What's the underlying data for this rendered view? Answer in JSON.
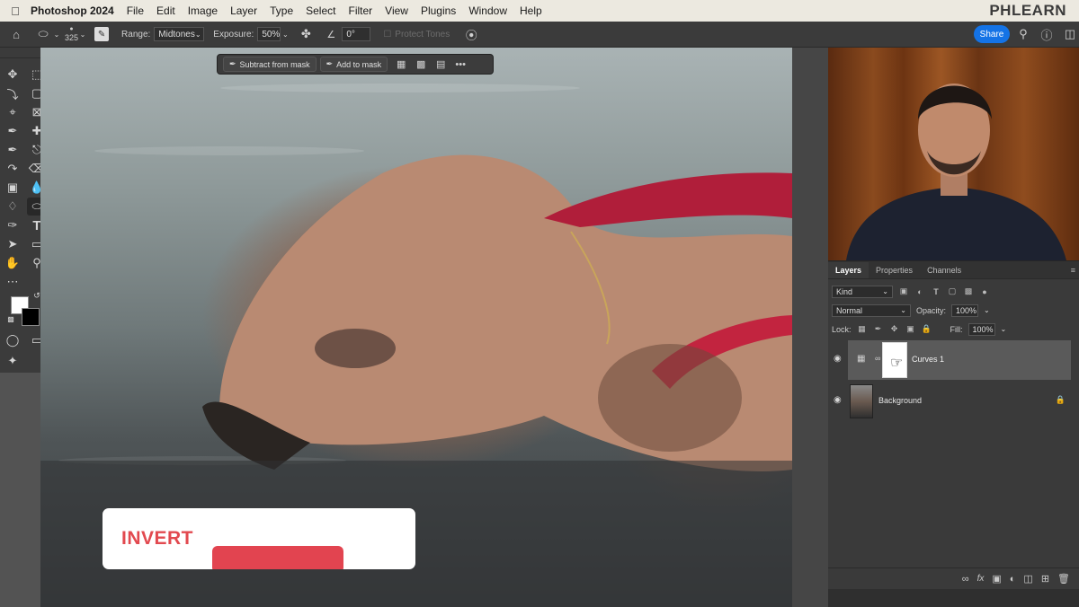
{
  "menubar": {
    "app_name": "Photoshop 2024",
    "menus": [
      "File",
      "Edit",
      "Image",
      "Layer",
      "Type",
      "Select",
      "Filter",
      "View",
      "Plugins",
      "Window",
      "Help"
    ],
    "brand": "PHLEARN"
  },
  "options_bar": {
    "brush_size": "325",
    "range_label": "Range:",
    "range_value": "Midtones",
    "exposure_label": "Exposure:",
    "exposure_value": "50%",
    "angle_value": "0°",
    "protect_tones_label": "Protect Tones",
    "share_label": "Share"
  },
  "context_bar": {
    "subtract_label": "Subtract from mask",
    "add_label": "Add to mask",
    "more_label": "•••"
  },
  "overlay": {
    "title": "INVERT"
  },
  "layers_panel": {
    "tabs": [
      "Layers",
      "Properties",
      "Channels"
    ],
    "filter_kind": "Kind",
    "blend_mode": "Normal",
    "opacity_label": "Opacity:",
    "opacity_value": "100%",
    "lock_label": "Lock:",
    "fill_label": "Fill:",
    "fill_value": "100%",
    "layers": [
      {
        "name": "Curves 1",
        "selected": true
      },
      {
        "name": "Background",
        "selected": false
      }
    ]
  },
  "colors": {
    "accent_blue": "#1473e6",
    "overlay_red": "#e2494f",
    "panel_bg": "#3a3a3a"
  }
}
